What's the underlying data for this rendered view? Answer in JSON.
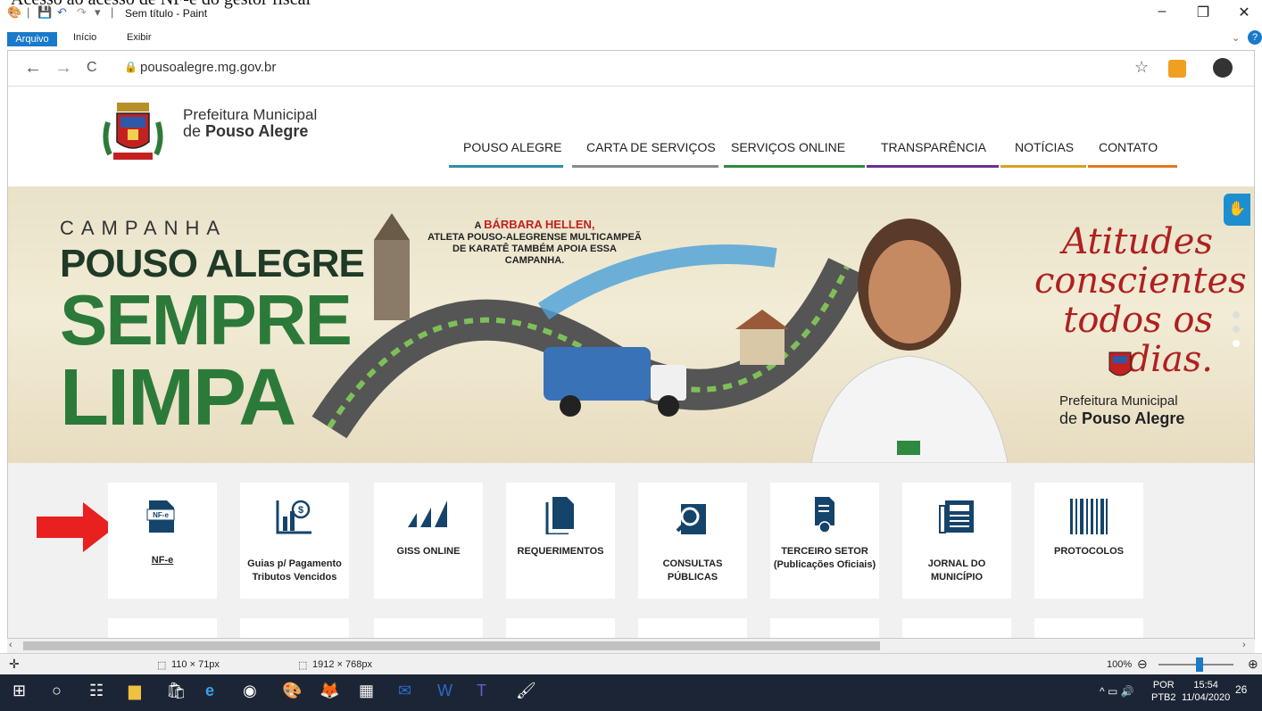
{
  "page": {
    "top_fragment": "Acesso ao acesso de NF-e do gestor fiscal"
  },
  "paint": {
    "title": "Sem título - Paint",
    "tabs": [
      "Arquivo",
      "Início",
      "Exibir"
    ],
    "window_controls": {
      "minimize": "–",
      "restore": "❐",
      "close": "✕"
    },
    "status": {
      "selection": "110 × 71px",
      "image_size": "1912 × 768px",
      "zoom": "100%"
    }
  },
  "browser": {
    "url": "pousoalegre.mg.gov.br",
    "nav": {
      "back": "←",
      "forward": "→",
      "reload": "C"
    }
  },
  "site": {
    "brand_line1": "Prefeitura Municipal",
    "brand_line2_prefix": "de ",
    "brand_line2_bold": "Pouso Alegre",
    "menu": [
      {
        "label": "POUSO ALEGRE",
        "color": "#2a8fa6"
      },
      {
        "label": "CARTA DE SERVIÇOS",
        "color": "#8a8a8a"
      },
      {
        "label": "SERVIÇOS ONLINE",
        "color": "#2e8a3e"
      },
      {
        "label": "TRANSPARÊNCIA",
        "color": "#6a2e93"
      },
      {
        "label": "NOTÍCIAS",
        "color": "#d8a020"
      },
      {
        "label": "CONTATO",
        "color": "#e07a20"
      }
    ]
  },
  "banner": {
    "campanha": "CAMPANHA",
    "pouso_alegre": "POUSO ALEGRE",
    "sempre": "SEMPRE",
    "limpa": "LIMPA",
    "text_a": "A ",
    "text_name": "BÁRBARA HELLEN,",
    "text_rest": "ATLETA POUSO-ALEGRENSE MULTICAMPEÃ DE KARATÊ TAMBÉM APOIA ESSA CAMPANHA.",
    "atitudes": "Atitudes conscientes todos os dias.",
    "pm_line1": "Prefeitura Municipal",
    "pm_line2_prefix": "de ",
    "pm_line2_bold": "Pouso Alegre"
  },
  "services": [
    {
      "label": "NF-e",
      "icon": "nfe-document-icon"
    },
    {
      "label": "Guias p/ Pagamento Tributos Vencidos",
      "icon": "chart-money-icon"
    },
    {
      "label": "GISS ONLINE",
      "icon": "bars-icon"
    },
    {
      "label": "REQUERIMENTOS",
      "icon": "documents-icon"
    },
    {
      "label": "CONSULTAS PÚBLICAS",
      "icon": "search-doc-icon"
    },
    {
      "label": "TERCEIRO SETOR (Publicações Oficiais)",
      "icon": "certificate-icon"
    },
    {
      "label": "JORNAL DO MUNICÍPIO",
      "icon": "newspaper-icon"
    },
    {
      "label": "PROTOCOLOS",
      "icon": "barcode-icon"
    }
  ],
  "taskbar": {
    "lang": "POR",
    "layout": "PTB2",
    "time": "15:54",
    "date": "11/04/2020",
    "notif": "26"
  }
}
